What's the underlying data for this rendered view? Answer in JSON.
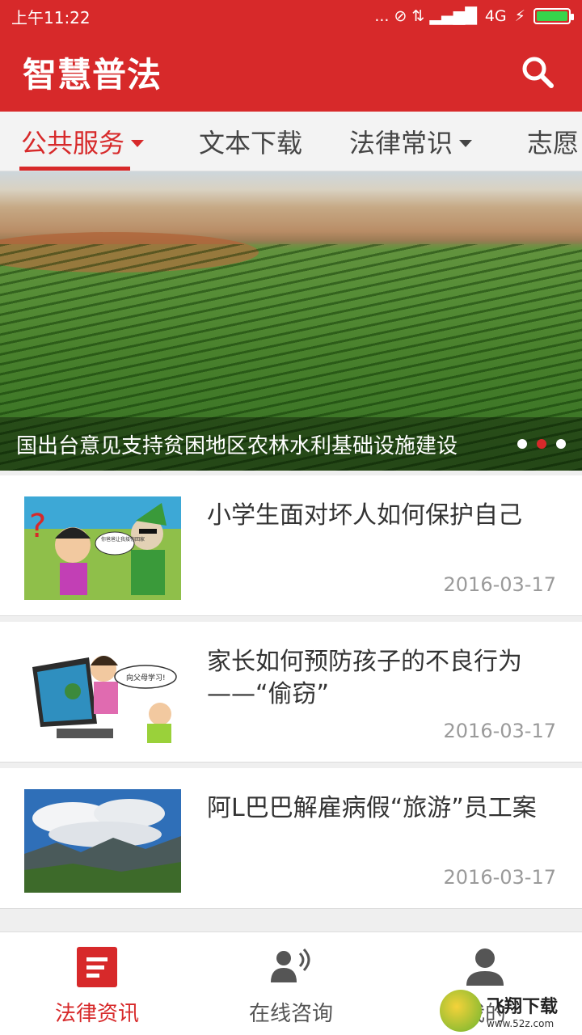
{
  "status_bar": {
    "time": "上午11:22",
    "network": "4G",
    "indicators": "... ⊘ ⇅ ▂▄▆█"
  },
  "app_bar": {
    "title": "智慧普法",
    "search_icon": "search-icon"
  },
  "tabs": [
    {
      "label": "公共服务",
      "has_dropdown": true,
      "active": true
    },
    {
      "label": "文本下载",
      "has_dropdown": false,
      "active": false
    },
    {
      "label": "法律常识",
      "has_dropdown": true,
      "active": false
    },
    {
      "label": "志愿",
      "has_dropdown": false,
      "active": false
    }
  ],
  "banner": {
    "caption": "国出台意见支持贫困地区农林水利基础设施建设",
    "dot_count": 3,
    "active_dot": 1
  },
  "news": [
    {
      "title": "小学生面对坏人如何保护自己",
      "date": "2016-03-17",
      "thumb_label": "你爸爸让我接你回家"
    },
    {
      "title": "家长如何预防孩子的不良行为——“偷窃”",
      "date": "2016-03-17",
      "thumb_label": "向父母学习!"
    },
    {
      "title": "阿L巴巴解雇病假“旅游”员工案",
      "date": "2016-03-17",
      "thumb_label": ""
    }
  ],
  "bottom_nav": [
    {
      "label": "法律资讯",
      "icon": "news-icon",
      "active": true
    },
    {
      "label": "在线咨询",
      "icon": "consult-icon",
      "active": false
    },
    {
      "label": "我的",
      "icon": "user-icon",
      "active": false
    }
  ],
  "watermark": {
    "main": "飞翔下载",
    "url": "www.52z.com"
  },
  "colors": {
    "primary": "#d7292a",
    "text": "#333333",
    "muted": "#9a9a9a"
  }
}
